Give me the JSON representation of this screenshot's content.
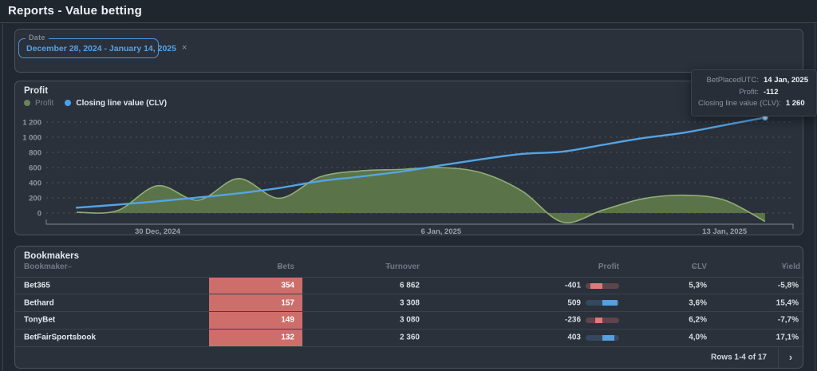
{
  "header": {
    "title": "Reports - Value betting"
  },
  "filters": {
    "date_label": "Date",
    "date_value": "December 28, 2024 - January 14, 2025",
    "clear_icon": "×"
  },
  "tooltip": {
    "rows": [
      {
        "label": "BetPlacedUTC:",
        "value": "14 Jan, 2025"
      },
      {
        "label": "Profit:",
        "value": "-112"
      },
      {
        "label": "Closing line value (CLV):",
        "value": "1 260"
      }
    ]
  },
  "chart_panel": {
    "title": "Profit",
    "legend": [
      {
        "label": "Profit",
        "color": "#7c9a62",
        "muted": true
      },
      {
        "label": "Closing line value (CLV)",
        "color": "#47a2e8",
        "muted": false
      }
    ]
  },
  "chart_data": {
    "type": "area+line",
    "title": "Profit",
    "x_dates": [
      "28 Dec 2024",
      "29 Dec 2024",
      "30 Dec 2024",
      "31 Dec 2024",
      "1 Jan 2025",
      "2 Jan 2025",
      "3 Jan 2025",
      "4 Jan 2025",
      "5 Jan 2025",
      "6 Jan 2025",
      "7 Jan 2025",
      "8 Jan 2025",
      "9 Jan 2025",
      "10 Jan 2025",
      "11 Jan 2025",
      "12 Jan 2025",
      "13 Jan 2025",
      "14 Jan 2025"
    ],
    "x_ticks": [
      {
        "index": 2,
        "label": "30 Dec, 2024"
      },
      {
        "index": 9,
        "label": "6 Jan, 2025"
      },
      {
        "index": 16,
        "label": "13 Jan, 2025"
      }
    ],
    "y_ticks": [
      {
        "value": 0,
        "label": "0"
      },
      {
        "value": 200,
        "label": "200"
      },
      {
        "value": 400,
        "label": "400"
      },
      {
        "value": 600,
        "label": "600"
      },
      {
        "value": 800,
        "label": "800"
      },
      {
        "value": 1000,
        "label": "1 000"
      },
      {
        "value": 1200,
        "label": "1 200"
      }
    ],
    "ylim": [
      -150,
      1340
    ],
    "grid": "dashed-horizontal",
    "legend_position": "top-left",
    "series": [
      {
        "name": "Profit",
        "type": "area",
        "stroke": "#93ad77",
        "fill": "#5e784a",
        "values": [
          10,
          30,
          360,
          170,
          455,
          195,
          475,
          555,
          575,
          600,
          530,
          290,
          -120,
          40,
          190,
          235,
          170,
          -112
        ]
      },
      {
        "name": "Closing line value (CLV)",
        "type": "line",
        "stroke": "#54a4e4",
        "end_dot": true,
        "values": [
          70,
          110,
          155,
          205,
          260,
          330,
          420,
          480,
          545,
          630,
          710,
          780,
          810,
          900,
          990,
          1060,
          1160,
          1260
        ]
      }
    ],
    "hovered_point": {
      "date": "14 Jan, 2025",
      "profit": -112,
      "clv": 1260
    }
  },
  "table": {
    "title": "Bookmakers",
    "columns": [
      {
        "key": "bookmaker",
        "label": "Bookmaker",
        "align": "left"
      },
      {
        "key": "bets",
        "label": "Bets",
        "align": "right"
      },
      {
        "key": "turnover",
        "label": "Turnover",
        "align": "right"
      },
      {
        "key": "profit",
        "label": "Profit",
        "align": "right"
      },
      {
        "key": "clv",
        "label": "CLV",
        "align": "right"
      },
      {
        "key": "yield",
        "label": "Yield",
        "align": "right"
      }
    ],
    "sort_dash": "–",
    "rows": [
      {
        "bookmaker": "Bet365",
        "bets": "354",
        "turnover": "6 862",
        "profit": "-401",
        "profit_num": -401,
        "clv": "5,3%",
        "yield": "-5,8%"
      },
      {
        "bookmaker": "Bethard",
        "bets": "157",
        "turnover": "3 308",
        "profit": "509",
        "profit_num": 509,
        "clv": "3,6%",
        "yield": "15,4%"
      },
      {
        "bookmaker": "TonyBet",
        "bets": "149",
        "turnover": "3 080",
        "profit": "-236",
        "profit_num": -236,
        "clv": "6,2%",
        "yield": "-7,7%"
      },
      {
        "bookmaker": "BetFairSportsbook",
        "bets": "132",
        "turnover": "2 360",
        "profit": "403",
        "profit_num": 403,
        "clv": "4,0%",
        "yield": "17,1%"
      }
    ],
    "footer": {
      "rows_label": "Rows 1-4 of 17",
      "next_icon": "›"
    }
  },
  "colors": {
    "accent_blue": "#54a4e4",
    "profit_green": "#5e784a",
    "bets_cell_red": "#ce6e6b",
    "bar_negative": "#e07a78",
    "bar_positive": "#54a0e0",
    "grid_line": "#767f8a",
    "axis_line": "#7f8994"
  }
}
